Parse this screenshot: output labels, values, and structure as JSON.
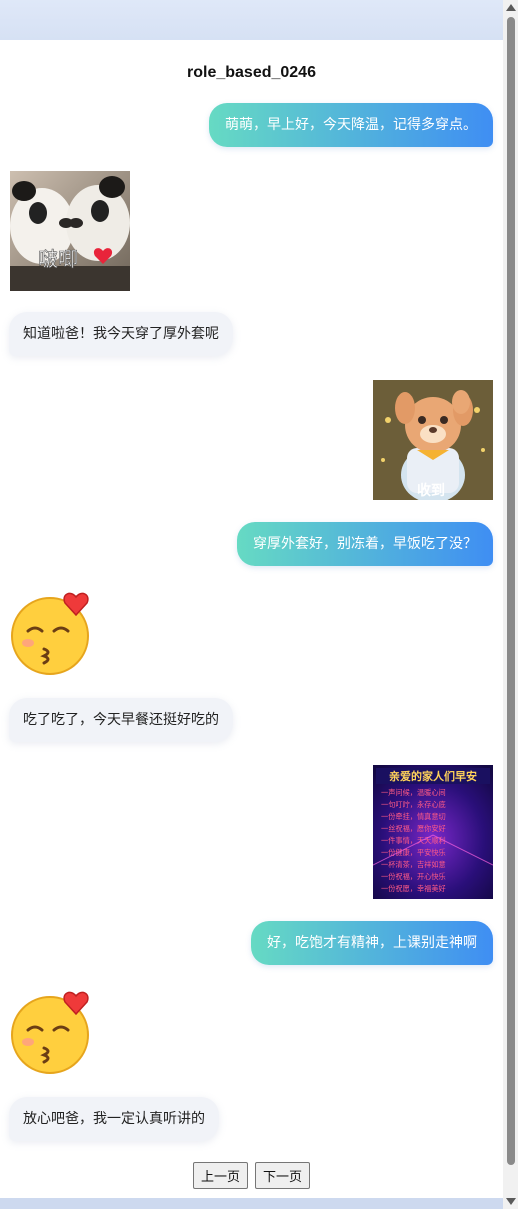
{
  "page": {
    "title": "role_based_0246"
  },
  "messages": [
    {
      "role": "user",
      "text": "萌萌，早上好，今天降温，记得多穿点。"
    },
    {
      "role": "bot",
      "sticker": "panda-kiss-sticker",
      "caption": "啵唧"
    },
    {
      "role": "bot",
      "text": "知道啦爸！我今天穿了厚外套呢"
    },
    {
      "role": "user",
      "sticker": "bear-salute-sticker",
      "caption": "收到"
    },
    {
      "role": "user",
      "text": "穿厚外套好，别冻着，早饭吃了没？"
    },
    {
      "role": "bot",
      "emoji": "kissing-face-heart-emoji"
    },
    {
      "role": "bot",
      "text": "吃了吃了，今天早餐还挺好吃的"
    },
    {
      "role": "user",
      "sticker": "good-morning-family-card",
      "caption": "亲爱的家人们早安",
      "lines": [
        "一声问候，温暖心间",
        "一句叮咛，永存心底",
        "一份牵挂，情真意切",
        "一丝祝福，愿你安好",
        "一件事情，天天顺利",
        "一份健康，平安快乐",
        "一杯清茶，吉祥如意",
        "一份祝福，开心快乐",
        "一份祝愿，幸福美好"
      ]
    },
    {
      "role": "user",
      "text": "好，吃饱才有精神，上课别走神啊"
    },
    {
      "role": "bot",
      "emoji": "kissing-face-heart-emoji"
    },
    {
      "role": "bot",
      "text": "放心吧爸，我一定认真听讲的"
    }
  ],
  "pagination": {
    "prev": "上一页",
    "next": "下一页"
  },
  "colors": {
    "user_bubble_start": "#66dac3",
    "user_bubble_end": "#3f8ef3",
    "bot_bubble": "#f1f3f8"
  }
}
